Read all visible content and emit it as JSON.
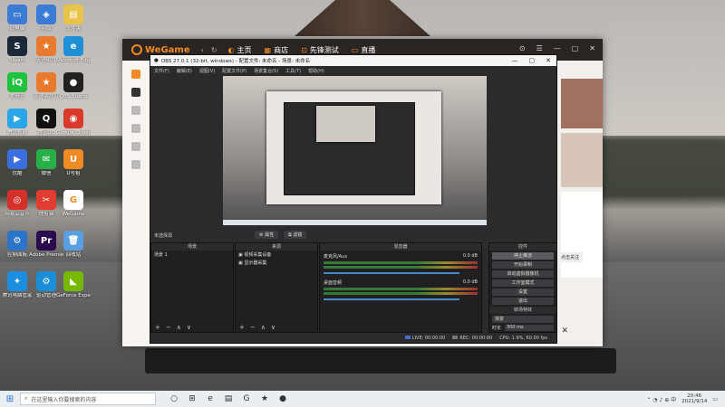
{
  "desktop_icons": [
    {
      "label": "此电脑",
      "color": "#3a7bd5",
      "glyph": "▭"
    },
    {
      "label": "网络",
      "color": "#3a7bd5",
      "glyph": "◈"
    },
    {
      "label": "文件夹",
      "color": "#e8c34a",
      "glyph": "▤"
    },
    {
      "label": "Steam",
      "color": "#1b2838",
      "glyph": "S"
    },
    {
      "label": "天涯明月",
      "color": "#e87a2e",
      "glyph": "★"
    },
    {
      "label": "Microsoft Edge",
      "color": "#1f8fd6",
      "glyph": "e"
    },
    {
      "label": "爱奇艺",
      "color": "#1ec23c",
      "glyph": "iQ"
    },
    {
      "label": "天涯明月刀",
      "color": "#e87a2e",
      "glyph": "★"
    },
    {
      "label": "OBS Studio",
      "color": "#222",
      "glyph": "●"
    },
    {
      "label": "腾讯视频",
      "color": "#2aa5e8",
      "glyph": "▶"
    },
    {
      "label": "腾讯QQ",
      "color": "#111",
      "glyph": "Q"
    },
    {
      "label": "Google Chrome",
      "color": "#d93a2a",
      "glyph": "◉"
    },
    {
      "label": "优酷",
      "color": "#3b6fe0",
      "glyph": "▶"
    },
    {
      "label": "微信",
      "color": "#27b048",
      "glyph": "✉"
    },
    {
      "label": "U号租",
      "color": "#f08a24",
      "glyph": "U"
    },
    {
      "label": "网易云音乐",
      "color": "#d6302a",
      "glyph": "◎"
    },
    {
      "label": "快剪辑",
      "color": "#e23c30",
      "glyph": "✂"
    },
    {
      "label": "WeGame",
      "color": "#fff",
      "glyph": "G"
    },
    {
      "label": "控制面板",
      "color": "#2c74c9",
      "glyph": "⚙"
    },
    {
      "label": "Adobe Premie...",
      "color": "#2a0a4d",
      "glyph": "Pr"
    },
    {
      "label": "回收站",
      "color": "#5aa0e0",
      "glyph": "🗑"
    },
    {
      "label": "腾讯电脑管家",
      "color": "#1b8ee0",
      "glyph": "✦"
    },
    {
      "label": "驱动管理",
      "color": "#1a8ed6",
      "glyph": "⚙"
    },
    {
      "label": "GeForce Experience",
      "color": "#76b900",
      "glyph": "◣"
    }
  ],
  "wegame": {
    "logo": "WeGame",
    "nav": [
      {
        "icon": "◐",
        "label": "主页"
      },
      {
        "icon": "▦",
        "label": "商店"
      },
      {
        "icon": "⊡",
        "label": "先锋测试"
      },
      {
        "icon": "▭",
        "label": "直播"
      }
    ],
    "controls": [
      "⊙",
      "☰",
      "—",
      "▢",
      "✕"
    ],
    "bottom_controls": [
      "Ⅱ",
      "✕"
    ],
    "side_popup": "点击关注"
  },
  "obs": {
    "title": "OBS 27.0.1 (32-bit, windows) - 配置文件: 未命名 - 场景: 未命名",
    "window_controls": [
      "—",
      "▢",
      "✕"
    ],
    "menu": [
      "文件(F)",
      "编辑(E)",
      "视图(V)",
      "配置文件(P)",
      "场景集合(S)",
      "工具(T)",
      "帮助(H)"
    ],
    "preview_label": "未选择源",
    "preview_buttons": [
      "⚙ 属性",
      "⧉ 滤镜"
    ],
    "scenes": {
      "header": "场景",
      "items": [
        "场景 1"
      ]
    },
    "sources": {
      "header": "来源",
      "items": [
        "视频采集设备",
        "显示器采集"
      ]
    },
    "mixer": {
      "header": "混音器",
      "tracks": [
        {
          "name": "麦克风/Aux",
          "db": "0.0 dB"
        },
        {
          "name": "桌面音频",
          "db": "0.0 dB"
        }
      ]
    },
    "controls": {
      "header": "控件",
      "buttons": [
        "停止推流",
        "开始录制",
        "启动虚拟摄像机",
        "工作室模式",
        "设置",
        "退出"
      ]
    },
    "transitions": {
      "header": "转场特效",
      "type": "渐变",
      "duration_label": "时长",
      "duration": "300 ms"
    },
    "dock_footer": [
      "+",
      "−",
      "∧",
      "∨"
    ],
    "status": {
      "live": "LIVE: 00:00:00",
      "rec": "REC: 00:00:00",
      "cpu": "CPU: 1.9%, 60.00 fps"
    }
  },
  "taskbar": {
    "search_placeholder": "在这里输入你要搜索的内容",
    "clock_time": "20:46",
    "clock_date": "2021/9/14",
    "apps": [
      "○",
      "⊞",
      "e",
      "▤",
      "G",
      "★",
      "●"
    ]
  }
}
